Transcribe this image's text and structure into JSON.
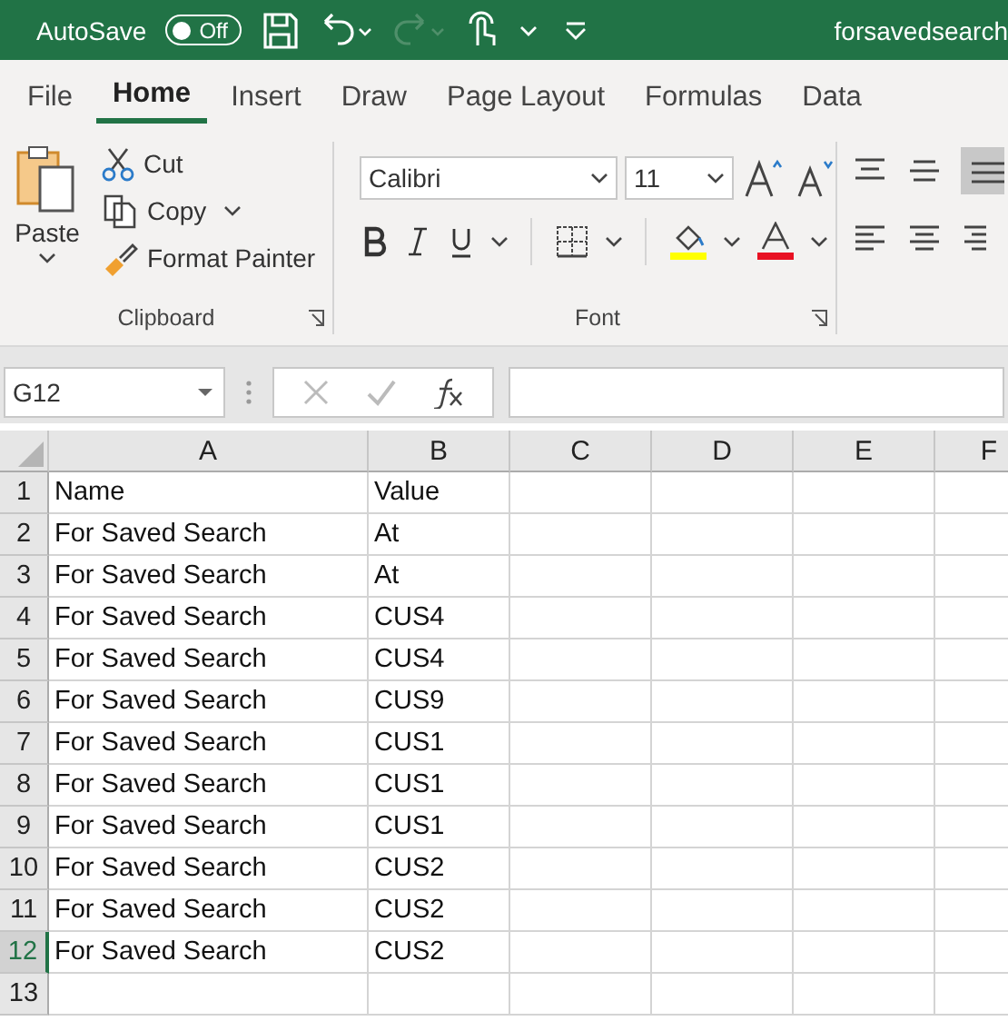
{
  "title_bar": {
    "autosave_label": "AutoSave",
    "autosave_toggle": {
      "label": "Off",
      "on": false
    },
    "filename": "forsavedsearch"
  },
  "ribbon_tabs": [
    {
      "label": "File",
      "selected": false
    },
    {
      "label": "Home",
      "selected": true
    },
    {
      "label": "Insert",
      "selected": false
    },
    {
      "label": "Draw",
      "selected": false
    },
    {
      "label": "Page Layout",
      "selected": false
    },
    {
      "label": "Formulas",
      "selected": false
    },
    {
      "label": "Data",
      "selected": false
    }
  ],
  "clipboard_group": {
    "paste": "Paste",
    "cut": "Cut",
    "copy": "Copy",
    "format_painter": "Format Painter",
    "label": "Clipboard"
  },
  "font_group": {
    "font_name": "Calibri",
    "font_size": "11",
    "label": "Font"
  },
  "formula_bar": {
    "name_box": "G12"
  },
  "sheet": {
    "columns": [
      "A",
      "B",
      "C",
      "D",
      "E",
      "F"
    ],
    "rows": [
      {
        "number": "1",
        "cells": [
          "Name",
          "Value"
        ],
        "selected": false
      },
      {
        "number": "2",
        "cells": [
          "For Saved Search",
          "At"
        ],
        "selected": false
      },
      {
        "number": "3",
        "cells": [
          "For Saved Search",
          "At"
        ],
        "selected": false
      },
      {
        "number": "4",
        "cells": [
          "For Saved Search",
          "CUS4"
        ],
        "selected": false
      },
      {
        "number": "5",
        "cells": [
          "For Saved Search",
          "CUS4"
        ],
        "selected": false
      },
      {
        "number": "6",
        "cells": [
          "For Saved Search",
          "CUS9"
        ],
        "selected": false
      },
      {
        "number": "7",
        "cells": [
          "For Saved Search",
          "CUS1"
        ],
        "selected": false
      },
      {
        "number": "8",
        "cells": [
          "For Saved Search",
          "CUS1"
        ],
        "selected": false
      },
      {
        "number": "9",
        "cells": [
          "For Saved Search",
          "CUS1"
        ],
        "selected": false
      },
      {
        "number": "10",
        "cells": [
          "For Saved Search",
          "CUS2"
        ],
        "selected": false
      },
      {
        "number": "11",
        "cells": [
          "For Saved Search",
          "CUS2"
        ],
        "selected": false
      },
      {
        "number": "12",
        "cells": [
          "For Saved Search",
          "CUS2"
        ],
        "selected": true
      },
      {
        "number": "13",
        "cells": [],
        "selected": false
      }
    ]
  }
}
